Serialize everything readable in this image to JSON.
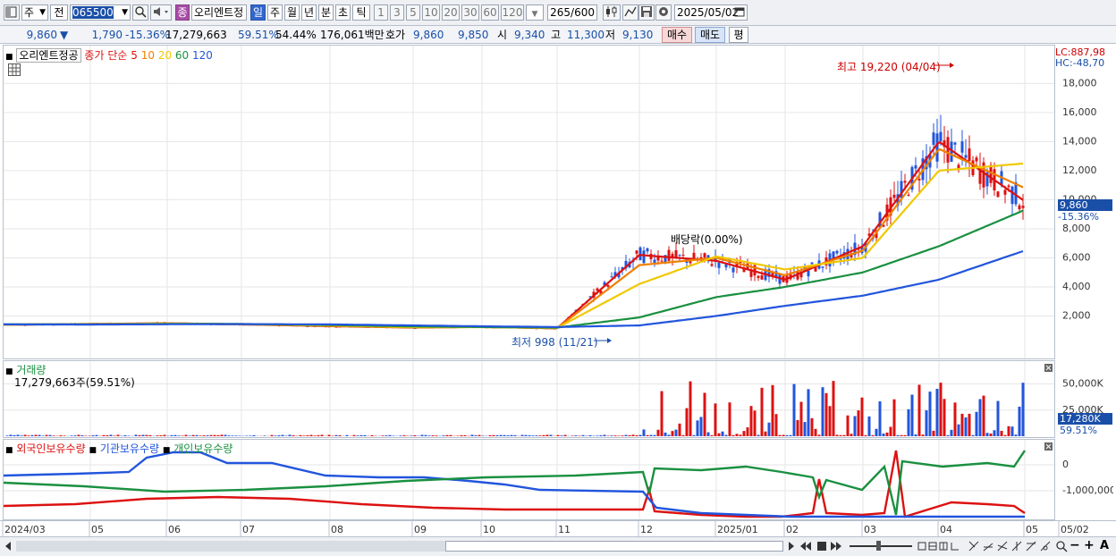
{
  "toolbar": {
    "market_type": "주",
    "prev_label": "전",
    "stock_code": "065500",
    "stock_name": "오리엔트정",
    "period_tabs": [
      "일",
      "주",
      "월",
      "년",
      "분",
      "초",
      "틱"
    ],
    "active_period": "일",
    "intervals": [
      "1",
      "3",
      "5",
      "10",
      "20",
      "30",
      "60",
      "120"
    ],
    "count": "265",
    "count_total": "/600",
    "date": "2025/05/02",
    "badge": "종"
  },
  "quote": {
    "price": "9,860",
    "direction": "▼",
    "change": "1,790",
    "change_pct": "-15.36%",
    "volume": "17,279,663",
    "volume_ratio": "59.51%",
    "turnover_pct": "54.44%",
    "trade_amount": "176,061백만",
    "ask_label": "호가",
    "ask1": "9,860",
    "ask2": "9,850",
    "open_label": "시",
    "open": "9,340",
    "high_label": "고",
    "high": "11,300",
    "low_label": "저",
    "low": "9,130",
    "buy": "매수",
    "sell": "매도",
    "eval": "평"
  },
  "price_panel": {
    "stock_label": "오리엔트정공",
    "legend_title": "종가 단순",
    "ma_periods": [
      "5",
      "10",
      "20",
      "60",
      "120"
    ],
    "ma_colors": [
      "#dd1111",
      "#f08000",
      "#f0c800",
      "#1a9040",
      "#2255dd"
    ],
    "lc_label": "LC:887,98",
    "hc_label": "HC:-48,70",
    "max_label": "최고 19,220 (04/04)",
    "min_label": "최저 998 (11/21)",
    "dividend_label": "배당락(0.00%)",
    "current_price_tag": "9,860",
    "current_pct_tag": "-15.36%"
  },
  "volume_panel": {
    "title": "거래량",
    "value_label": "17,279,663주(59.51%)",
    "current_tag": "17,280K",
    "current_pct": "59.51%"
  },
  "holdings_panel": {
    "series_names": [
      "외국인보유수량",
      "기관보유수량",
      "개인보유수량"
    ],
    "series_colors": [
      "#dd1111",
      "#2255dd",
      "#1a9040"
    ]
  },
  "dates": [
    "2024/03",
    "05",
    "06",
    "07",
    "08",
    "09",
    "10",
    "11",
    "12",
    "2025/01",
    "02",
    "03",
    "04",
    "05",
    "05/02"
  ],
  "chart_data": [
    {
      "type": "line",
      "title": "오리엔트정공",
      "y_ticks": [
        2000,
        4000,
        6000,
        8000,
        10000,
        12000,
        14000,
        16000,
        18000
      ],
      "y_tick_labels": [
        "2,000",
        "4,000",
        "6,000",
        "8,000",
        "10,000",
        "12,000",
        "14,000",
        "16,000",
        "18,000"
      ],
      "ylim": [
        0,
        19500
      ],
      "categories": [
        "2024/03",
        "05",
        "06",
        "07",
        "08",
        "09",
        "10",
        "11",
        "12",
        "2025/01",
        "02",
        "03",
        "04",
        "05"
      ],
      "series": [
        {
          "name": "5",
          "values": [
            1400,
            1450,
            1500,
            1420,
            1300,
            1200,
            1250,
            1150,
            6200,
            5800,
            4500,
            6800,
            14000,
            9900
          ]
        },
        {
          "name": "10",
          "values": [
            1400,
            1440,
            1490,
            1430,
            1320,
            1210,
            1240,
            1160,
            5500,
            6000,
            4800,
            6500,
            13500,
            10800
          ]
        },
        {
          "name": "20",
          "values": [
            1410,
            1430,
            1480,
            1440,
            1340,
            1230,
            1230,
            1180,
            4200,
            6100,
            5200,
            6000,
            12000,
            12500
          ]
        },
        {
          "name": "60",
          "values": [
            1420,
            1420,
            1450,
            1450,
            1380,
            1280,
            1240,
            1200,
            1900,
            3300,
            4000,
            5000,
            6800,
            9300
          ]
        },
        {
          "name": "120",
          "values": [
            1420,
            1410,
            1430,
            1440,
            1420,
            1350,
            1290,
            1240,
            1350,
            2000,
            2700,
            3400,
            4500,
            6500
          ]
        }
      ]
    },
    {
      "type": "bar",
      "title": "거래량",
      "y_ticks": [
        25000,
        50000
      ],
      "y_tick_labels": [
        "25,000K",
        "50,000K"
      ],
      "ylim": [
        0,
        65000
      ],
      "current_value": 17280
    },
    {
      "type": "line",
      "y_ticks": [
        0,
        -1000000
      ],
      "y_tick_labels": [
        "0",
        "-1,000,000"
      ],
      "series": [
        {
          "name": "외국인보유수량"
        },
        {
          "name": "기관보유수량"
        },
        {
          "name": "개인보유수량"
        }
      ]
    }
  ]
}
